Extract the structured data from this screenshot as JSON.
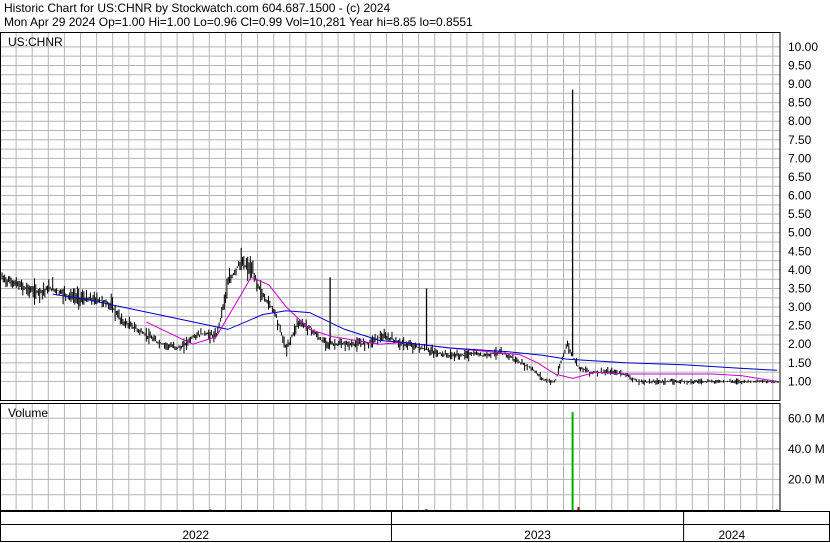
{
  "header": {
    "line1": "Historic Chart for US:CHNR by Stockwatch.com 604.687.1500 - (c) 2024",
    "line2": "Mon Apr 29 2024  Op=1.00  Hi=1.00  Lo=0.96  Cl=0.99  Vol=10,281  Year hi=8.85  lo=0.8551"
  },
  "colors": {
    "price_bar": "#000000",
    "ma_short": "#cc00cc",
    "ma_long": "#0000cc",
    "volume_bar": "#00aa00",
    "volume_bar_alt": "#cc0000",
    "grid": "#b4b4b4"
  },
  "chart_data": [
    {
      "type": "line",
      "subtype": "ohlc",
      "label": "US:CHNR",
      "ylim": [
        0.5,
        10.4
      ],
      "y_ticks": [
        "10.00",
        "9.50",
        "9.00",
        "8.50",
        "8.00",
        "7.50",
        "7.00",
        "6.50",
        "6.00",
        "5.50",
        "5.00",
        "4.50",
        "4.00",
        "3.50",
        "3.00",
        "2.50",
        "2.00",
        "1.50",
        "1.00"
      ],
      "y_tick_values": [
        10.0,
        9.5,
        9.0,
        8.5,
        8.0,
        7.5,
        7.0,
        6.5,
        6.0,
        5.5,
        5.0,
        4.5,
        4.0,
        3.5,
        3.0,
        2.5,
        2.0,
        1.5,
        1.0
      ],
      "x_ticks": [
        "2022",
        "2023",
        "2024"
      ],
      "x_range": [
        2021.66,
        2024.33
      ],
      "x_boundaries": [
        2023.0,
        2024.0
      ],
      "grid": true,
      "series": [
        {
          "role": "close",
          "x": [
            2021.66,
            2021.72,
            2021.78,
            2021.84,
            2021.9,
            2021.96,
            2022.0,
            2022.04,
            2022.08,
            2022.12,
            2022.16,
            2022.2,
            2022.24,
            2022.28,
            2022.32,
            2022.36,
            2022.4,
            2022.44,
            2022.48,
            2022.52,
            2022.56,
            2022.6,
            2022.64,
            2022.68,
            2022.72,
            2022.76,
            2022.8,
            2022.84,
            2022.88,
            2022.92,
            2022.96,
            2023.0,
            2023.04,
            2023.08,
            2023.12,
            2023.16,
            2023.2,
            2023.24,
            2023.28,
            2023.32,
            2023.36,
            2023.4,
            2023.44,
            2023.48,
            2023.52,
            2023.56,
            2023.6,
            2023.64,
            2023.68,
            2023.72,
            2023.76,
            2023.8,
            2023.84,
            2023.88,
            2023.92,
            2023.96,
            2024.0,
            2024.04,
            2024.08,
            2024.12,
            2024.16,
            2024.2,
            2024.24,
            2024.28,
            2024.32
          ],
          "values": [
            3.8,
            3.6,
            3.4,
            3.5,
            3.3,
            3.2,
            3.2,
            3.05,
            2.6,
            2.45,
            2.25,
            2.05,
            1.95,
            1.9,
            2.2,
            2.3,
            2.2,
            3.6,
            4.2,
            4.0,
            3.3,
            2.9,
            1.85,
            2.6,
            2.45,
            2.1,
            2.0,
            2.0,
            2.0,
            2.05,
            2.2,
            2.15,
            2.0,
            1.95,
            1.85,
            1.75,
            1.7,
            1.7,
            1.75,
            1.7,
            1.78,
            1.7,
            1.5,
            1.35,
            1.05,
            0.98,
            2.0,
            1.4,
            1.25,
            1.25,
            1.25,
            1.2,
            1.0,
            0.99,
            1.0,
            1.0,
            1.0,
            1.0,
            1.0,
            1.0,
            1.0,
            1.0,
            1.0,
            1.0,
            0.99
          ]
        },
        {
          "role": "moving_average_short",
          "x": [
            2022.16,
            2022.24,
            2022.32,
            2022.4,
            2022.46,
            2022.52,
            2022.58,
            2022.64,
            2022.72,
            2022.8,
            2022.88,
            2022.96,
            2023.04,
            2023.2,
            2023.36,
            2023.44,
            2023.5,
            2023.56,
            2023.62,
            2023.7,
            2023.8,
            2023.9,
            2023.98,
            2024.1,
            2024.2,
            2024.32
          ],
          "values": [
            2.6,
            2.3,
            2.0,
            2.2,
            3.0,
            3.8,
            3.6,
            3.0,
            2.4,
            2.2,
            2.1,
            2.0,
            2.05,
            1.9,
            1.78,
            1.72,
            1.5,
            1.2,
            1.08,
            1.25,
            1.2,
            1.2,
            1.2,
            1.2,
            1.15,
            1.0
          ]
        },
        {
          "role": "moving_average_long",
          "x": [
            2021.84,
            2021.96,
            2022.08,
            2022.2,
            2022.32,
            2022.44,
            2022.56,
            2022.64,
            2022.72,
            2022.84,
            2022.96,
            2023.04,
            2023.2,
            2023.4,
            2023.52,
            2023.6,
            2023.8,
            2024.0,
            2024.2,
            2024.32
          ],
          "values": [
            3.35,
            3.2,
            3.0,
            2.8,
            2.6,
            2.4,
            2.8,
            2.9,
            2.85,
            2.4,
            2.1,
            2.05,
            1.9,
            1.8,
            1.7,
            1.6,
            1.5,
            1.45,
            1.35,
            1.3
          ]
        }
      ],
      "spikes": [
        {
          "x": 2022.79,
          "high": 3.8
        },
        {
          "x": 2023.12,
          "high": 3.5
        },
        {
          "x": 2023.62,
          "high": 8.85
        }
      ]
    },
    {
      "type": "bar",
      "label": "Volume",
      "ylim": [
        0,
        70
      ],
      "y_ticks": [
        "60.0 M",
        "40.0 M",
        "20.0 M"
      ],
      "y_tick_values": [
        60,
        40,
        20
      ],
      "x": [
        2022.38,
        2023.12,
        2023.62,
        2023.64,
        2024.32
      ],
      "values": [
        0.4,
        0.6,
        64.0,
        2.0,
        0.3
      ],
      "grid": true
    }
  ]
}
